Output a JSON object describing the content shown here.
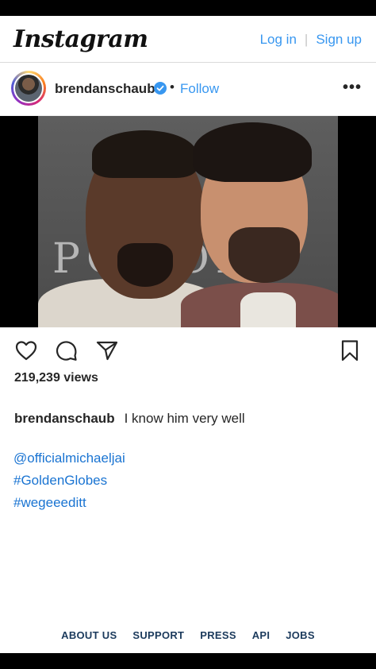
{
  "header": {
    "logo": "Instagram",
    "login": "Log in",
    "separator": "|",
    "signup": "Sign up"
  },
  "post": {
    "username": "brendanschaub",
    "dot": "•",
    "follow": "Follow",
    "more": "•••",
    "photo_text": "POWOR",
    "views": "219,239 views",
    "caption_user": "brendanschaub",
    "caption_text": "I know him very well",
    "mentions": [
      "@officialmichaeljai",
      "#GoldenGlobes",
      "#wegeeeditt"
    ]
  },
  "footer": {
    "links": [
      "ABOUT US",
      "SUPPORT",
      "PRESS",
      "API",
      "JOBS"
    ]
  },
  "colors": {
    "accent": "#3897f0",
    "link": "#1a74d2",
    "footer": "#1b3a5c"
  },
  "icons": [
    "heart-icon",
    "comment-icon",
    "share-icon",
    "bookmark-icon",
    "verified-icon"
  ]
}
